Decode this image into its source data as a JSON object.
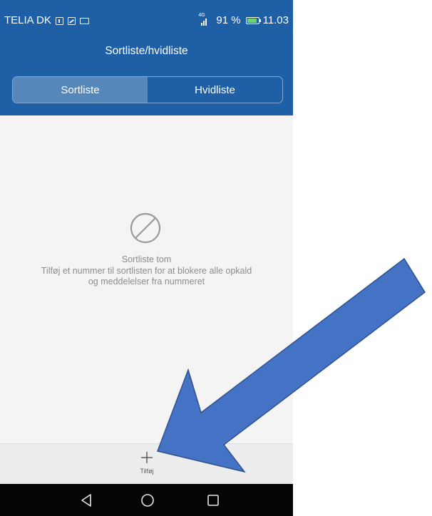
{
  "status_bar": {
    "carrier": "TELIA DK",
    "network": "4G",
    "battery_text": "91 %",
    "battery_level": 0.91,
    "time": "11.03",
    "battery_color": "#6fd36f"
  },
  "header": {
    "title": "Sortliste/hvidliste",
    "background_color": "#1e5fa5"
  },
  "tabs": [
    {
      "label": "Sortliste",
      "selected": true
    },
    {
      "label": "Hvidliste",
      "selected": false
    }
  ],
  "empty_state": {
    "icon": "blocked-icon",
    "title": "Sortliste tom",
    "line1": "Tilføj et nummer til sortlisten for at blokere alle opkald",
    "line2": "og meddelelser fra nummeret"
  },
  "bottom_bar": {
    "add_icon": "plus-icon",
    "add_label": "Tilføj"
  },
  "nav_bar": {
    "buttons": [
      "back-icon",
      "home-icon",
      "recents-icon"
    ]
  },
  "annotation": {
    "type": "arrow",
    "color": "#4472c4",
    "border_color": "#2f528f"
  }
}
